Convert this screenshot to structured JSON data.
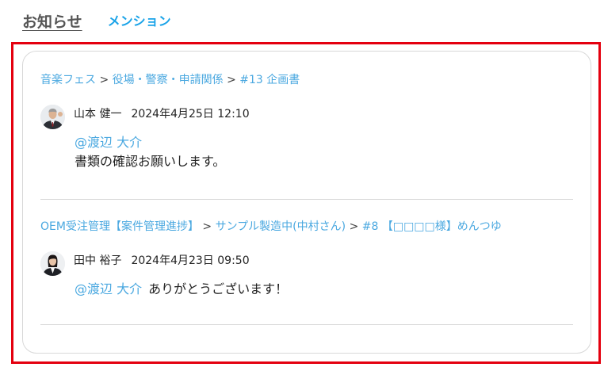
{
  "tabs": {
    "notice": "お知らせ",
    "mention": "メンション"
  },
  "notices": [
    {
      "breadcrumb": [
        "音楽フェス",
        "役場・警察・申請関係",
        "#13 企画書"
      ],
      "author": "山本 健一",
      "time": "2024年4月25日 12:10",
      "mention": "@渡辺 大介",
      "message": "書類の確認お願いします。"
    },
    {
      "breadcrumb": [
        "OEM受注管理【案件管理進捗】",
        "サンプル製造中(中村さん)",
        "#8 【□□□□様】めんつゆ"
      ],
      "author": "田中 裕子",
      "time": "2024年4月23日 09:50",
      "mention": "@渡辺 大介",
      "message": "ありがとうございます！"
    }
  ],
  "separator": ">"
}
